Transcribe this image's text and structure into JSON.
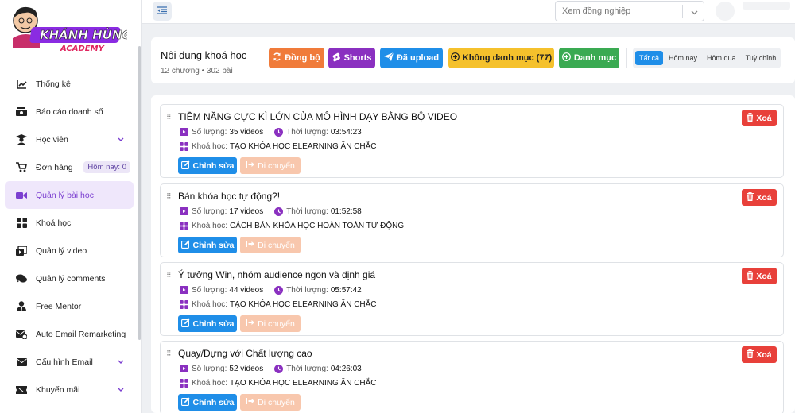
{
  "brand": {
    "logo_line1": "KHÁNH HÙNG",
    "logo_line2": "ACADEMY"
  },
  "sidebar": {
    "items": [
      {
        "label": "Thống kê",
        "icon": "chart-line-icon"
      },
      {
        "label": "Báo cáo doanh số",
        "icon": "money-bill-icon"
      },
      {
        "label": "Học viên",
        "icon": "graduate-icon",
        "has_submenu": true
      },
      {
        "label": "Đơn hàng",
        "icon": "cart-icon",
        "badge": "Hôm nay: 0"
      },
      {
        "label": "Quản lý bài học",
        "icon": "video-icon",
        "active": true
      },
      {
        "label": "Khoá học",
        "icon": "grid-icon"
      },
      {
        "label": "Quản lý video",
        "icon": "film-icon"
      },
      {
        "label": "Quản lý comments",
        "icon": "comments-icon"
      },
      {
        "label": "Free Mentor",
        "icon": "user-tie-icon"
      },
      {
        "label": "Auto Email Remarketing",
        "icon": "email-auto-icon"
      },
      {
        "label": "Cấu hình Email",
        "icon": "envelope-icon",
        "has_submenu": true
      },
      {
        "label": "Khuyến mãi",
        "icon": "ticket-icon",
        "has_submenu": true
      }
    ]
  },
  "header": {
    "colleague_placeholder": "Xem đồng nghiệp"
  },
  "course": {
    "title": "Nội dung khoá học",
    "subtitle": "12 chương • 302 bài",
    "buttons": {
      "sync": "Đồng bộ",
      "shorts": "Shorts",
      "uploaded": "Đã upload",
      "no_category": "Không danh mục (77)",
      "category": "Danh mục"
    },
    "filters": [
      "Tất cả",
      "Hôm nay",
      "Hôm qua",
      "Tuỳ chỉnh"
    ]
  },
  "labels": {
    "count": "Số lượng:",
    "duration": "Thời lượng:",
    "course": "Khoá học:",
    "edit": "Chỉnh sửa",
    "move": "Di chuyển",
    "delete": "Xoá"
  },
  "lessons": [
    {
      "title": "TIỀM NĂNG CỰC KÌ LỚN CỦA MÔ HÌNH DẠY BẰNG BỘ VIDEO",
      "count": "35 videos",
      "duration": "03:54:23",
      "course": "TẠO KHÓA HỌC ELEARNING ĂN CHẮC"
    },
    {
      "title": "Bán khóa học tự động?!",
      "count": "17 videos",
      "duration": "01:52:58",
      "course": "CÁCH BÁN KHÓA HỌC HOÀN TOÀN TỰ ĐỘNG"
    },
    {
      "title": "Ý tưởng Win, nhóm audience ngon và định giá",
      "count": "44 videos",
      "duration": "05:57:42",
      "course": "TẠO KHÓA HỌC ELEARNING ĂN CHẮC"
    },
    {
      "title": "Quay/Dựng với Chất lượng cao",
      "count": "52 videos",
      "duration": "04:26:03",
      "course": "TẠO KHÓA HỌC ELEARNING ĂN CHẮC"
    }
  ],
  "colors": {
    "accent_purple": "#7b3fd0",
    "sync_orange": "#f07b3a",
    "shorts_purple": "#8a30c0",
    "upload_blue": "#1f8ee8",
    "nocat_yellow": "#f5c12c",
    "cat_green": "#3aaa52",
    "delete_red": "#e8403a",
    "move_peach": "#f8c7ad"
  }
}
